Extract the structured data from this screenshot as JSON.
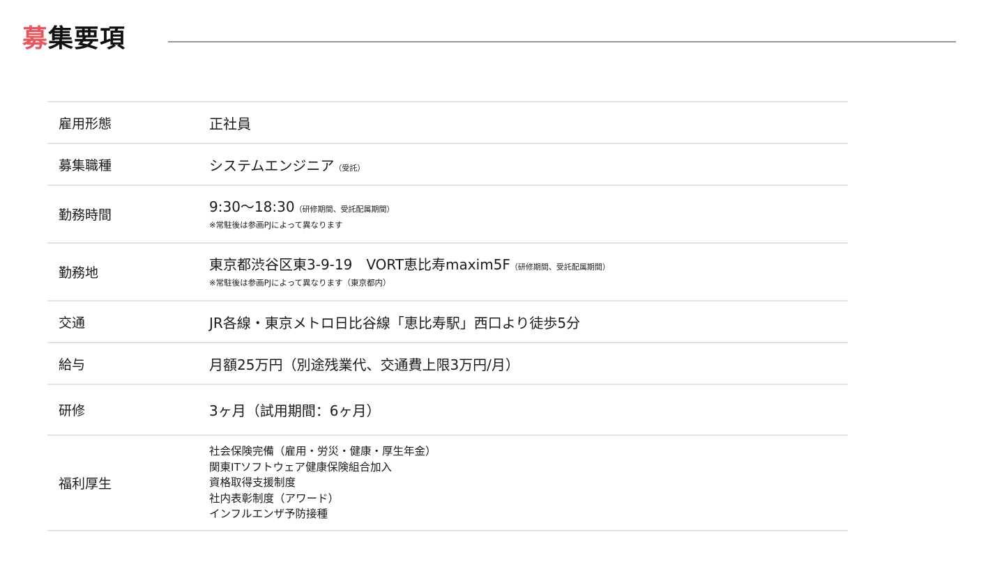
{
  "header": {
    "title_accent": "募",
    "title_rest": "集要項"
  },
  "rows": [
    {
      "label": "雇用形態",
      "value": "正社員"
    },
    {
      "label": "募集職種",
      "value": "システムエンジニア",
      "suffix": "（受託）"
    },
    {
      "label": "勤務時間",
      "value": "9:30〜18:30",
      "suffix": "（研修期間、受託配属期間）",
      "note": "※常駐後は参画PJによって異なります"
    },
    {
      "label": "勤務地",
      "value": "東京都渋谷区東3-9-19　VORT恵比寿maxim5F",
      "suffix": "（研修期間、受託配属期間）",
      "note": "※常駐後は参画PJによって異なります（東京都内）"
    },
    {
      "label": "交通",
      "value": "JR各線・東京メトロ日比谷線「恵比寿駅」西口より徒歩5分"
    },
    {
      "label": "給与",
      "value": "月額25万円（別途残業代、交通費上限3万円/月）"
    },
    {
      "label": "研修",
      "value": "3ヶ月（試用期間：6ヶ月）"
    },
    {
      "label": "福利厚生",
      "lines": [
        "社会保険完備（雇用・労災・健康・厚生年金）",
        "関東ITソフトウェア健康保険組合加入",
        "資格取得支援制度",
        "社内表彰制度（アワード）",
        "インフルエンザ予防接種"
      ]
    }
  ]
}
